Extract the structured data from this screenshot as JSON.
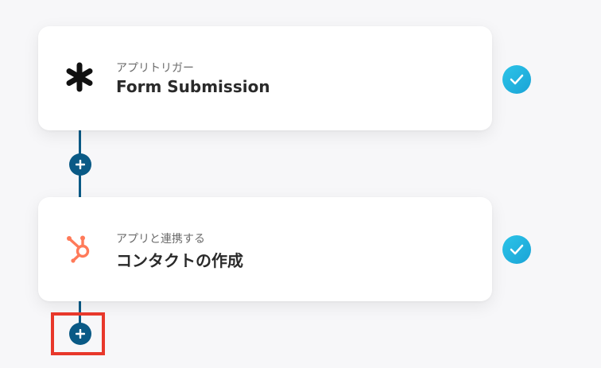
{
  "steps": [
    {
      "subtitle": "アプリトリガー",
      "title": "Form Submission",
      "icon": "asterisk-icon",
      "status": "completed"
    },
    {
      "subtitle": "アプリと連携する",
      "title": "コンタクトの作成",
      "icon": "hubspot-icon",
      "status": "completed"
    }
  ],
  "colors": {
    "connector": "#0a5a86",
    "check": "#1ab0de",
    "hubspot": "#ff7a59",
    "highlight": "#e8382b"
  }
}
